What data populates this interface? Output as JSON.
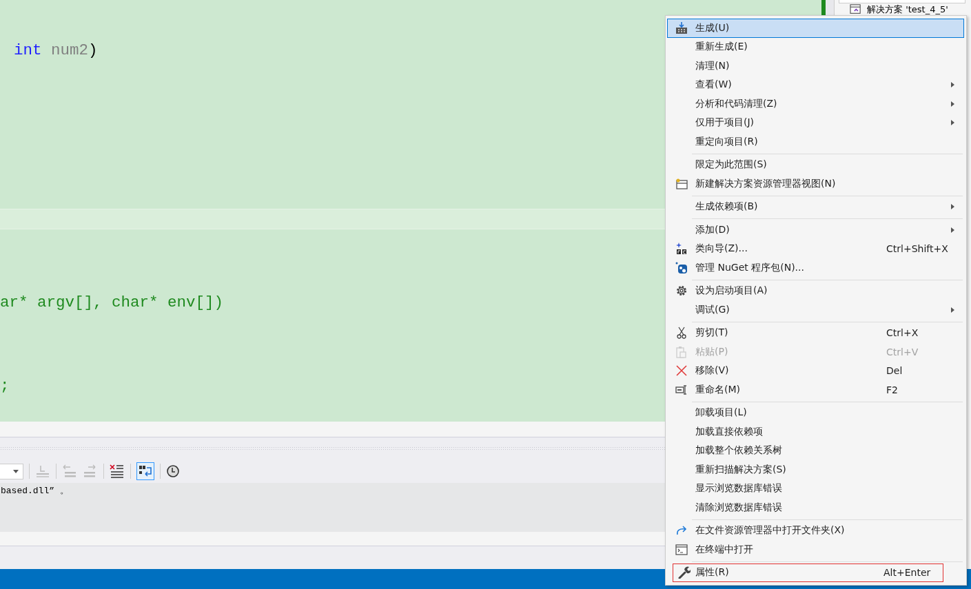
{
  "editor": {
    "lines": [
      [
        {
          "kind": "keyword",
          "text": "int"
        },
        {
          "kind": "param",
          "text": " num2"
        },
        {
          "kind": "plain",
          "text": ")"
        }
      ],
      [
        {
          "kind": "comment",
          "text": "ar* argv[], char* env[])"
        }
      ],
      [
        {
          "kind": "comment",
          "text": ";"
        }
      ]
    ]
  },
  "output": {
    "text": "based.dll” 。",
    "word_wrap_on": true
  },
  "solution_explorer": {
    "item": "解决方案 'test_4_5'"
  },
  "context_menu": {
    "sections": [
      [
        {
          "label": "生成(U)",
          "selected": true,
          "disabled": false,
          "submenu": false
        },
        {
          "label": "重新生成(E)",
          "selected": false,
          "disabled": false,
          "submenu": false
        },
        {
          "label": "清理(N)",
          "selected": false,
          "disabled": false,
          "submenu": false
        },
        {
          "label": "查看(W)",
          "selected": false,
          "disabled": false,
          "submenu": true
        },
        {
          "label": "分析和代码清理(Z)",
          "selected": false,
          "disabled": false,
          "submenu": true
        },
        {
          "label": "仅用于项目(J)",
          "selected": false,
          "disabled": false,
          "submenu": true
        },
        {
          "label": "重定向项目(R)",
          "selected": false,
          "disabled": false,
          "submenu": false
        }
      ],
      [
        {
          "label": "限定为此范围(S)",
          "selected": false,
          "disabled": false,
          "submenu": false
        },
        {
          "label": "新建解决方案资源管理器视图(N)",
          "selected": false,
          "disabled": false,
          "submenu": false
        }
      ],
      [
        {
          "label": "生成依赖项(B)",
          "selected": false,
          "disabled": false,
          "submenu": true
        }
      ],
      [
        {
          "label": "添加(D)",
          "selected": false,
          "disabled": false,
          "submenu": true
        },
        {
          "label": "类向导(Z)...",
          "shortcut": "Ctrl+Shift+X",
          "selected": false,
          "disabled": false,
          "submenu": false
        },
        {
          "label": "管理 NuGet 程序包(N)...",
          "selected": false,
          "disabled": false,
          "submenu": false
        }
      ],
      [
        {
          "label": "设为启动项目(A)",
          "selected": false,
          "disabled": false,
          "submenu": false
        },
        {
          "label": "调试(G)",
          "selected": false,
          "disabled": false,
          "submenu": true
        }
      ],
      [
        {
          "label": "剪切(T)",
          "shortcut": "Ctrl+X",
          "selected": false,
          "disabled": false,
          "submenu": false
        },
        {
          "label": "粘贴(P)",
          "shortcut": "Ctrl+V",
          "selected": false,
          "disabled": true,
          "submenu": false
        },
        {
          "label": "移除(V)",
          "shortcut": "Del",
          "selected": false,
          "disabled": false,
          "submenu": false
        },
        {
          "label": "重命名(M)",
          "shortcut": "F2",
          "selected": false,
          "disabled": false,
          "submenu": false
        }
      ],
      [
        {
          "label": "卸载项目(L)",
          "selected": false,
          "disabled": false,
          "submenu": false
        },
        {
          "label": "加载直接依赖项",
          "selected": false,
          "disabled": false,
          "submenu": false
        },
        {
          "label": "加载整个依赖关系树",
          "selected": false,
          "disabled": false,
          "submenu": false
        },
        {
          "label": "重新扫描解决方案(S)",
          "selected": false,
          "disabled": false,
          "submenu": false
        },
        {
          "label": "显示浏览数据库错误",
          "selected": false,
          "disabled": false,
          "submenu": false
        },
        {
          "label": "清除浏览数据库错误",
          "selected": false,
          "disabled": false,
          "submenu": false
        }
      ],
      [
        {
          "label": "在文件资源管理器中打开文件夹(X)",
          "selected": false,
          "disabled": false,
          "submenu": false
        },
        {
          "label": "在终端中打开",
          "selected": false,
          "disabled": false,
          "submenu": false
        }
      ],
      [
        {
          "label": "属性(R)",
          "shortcut": "Alt+Enter",
          "selected": false,
          "disabled": false,
          "submenu": false,
          "annotated": true
        }
      ]
    ]
  }
}
